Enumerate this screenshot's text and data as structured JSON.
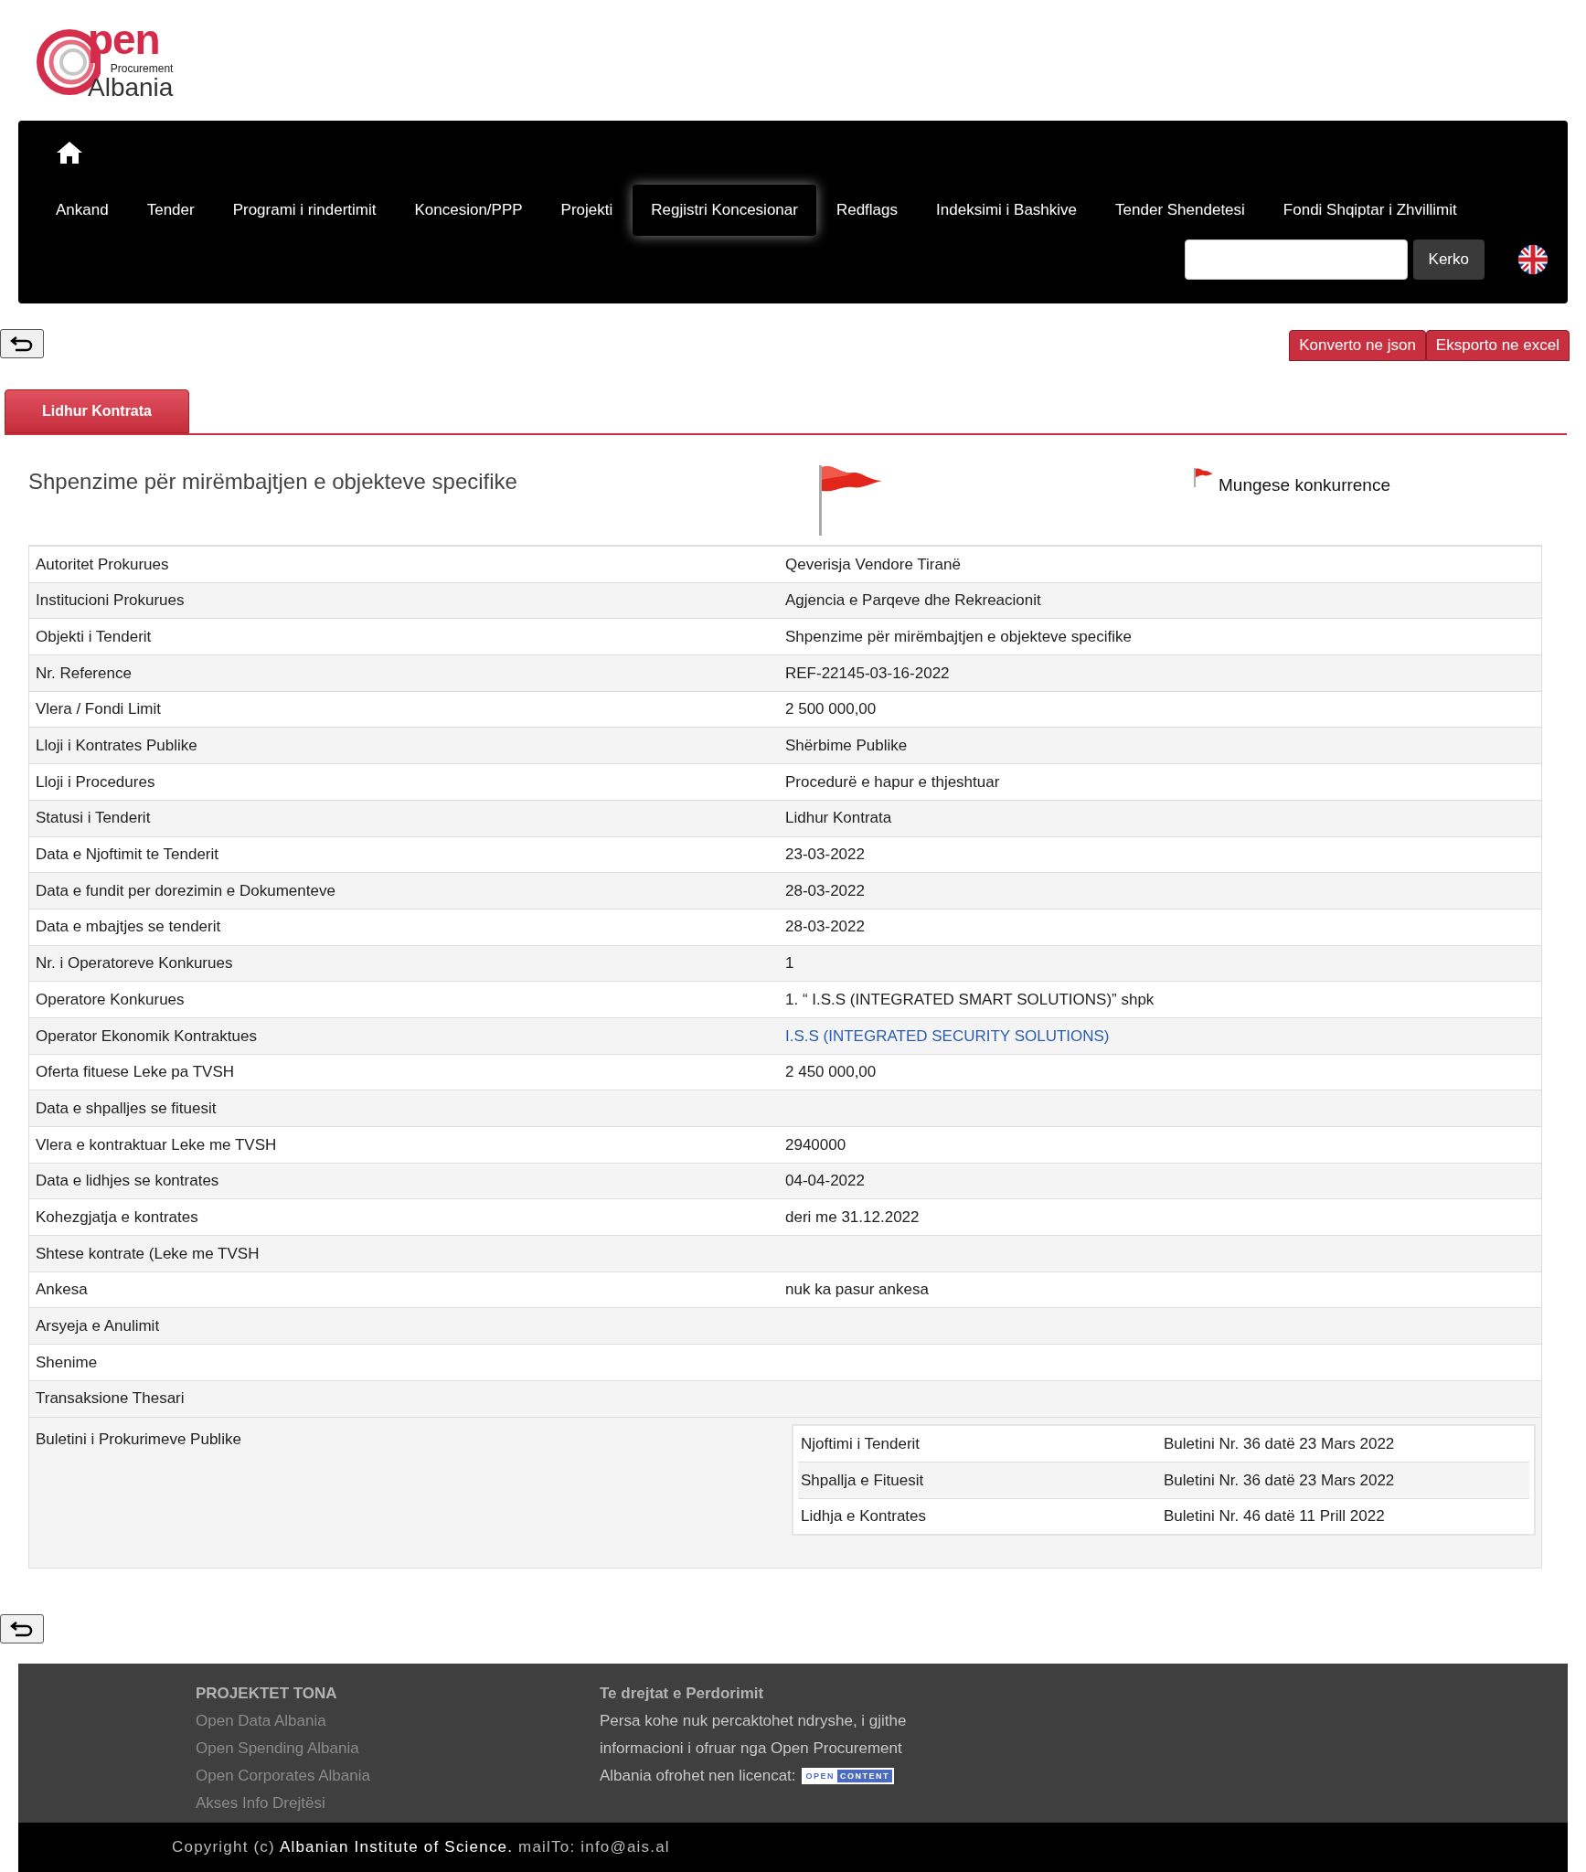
{
  "logo": {
    "word": "pen",
    "tagline": "Procurement",
    "country": "Albania"
  },
  "nav": {
    "items": [
      {
        "label": "Ankand",
        "selected": false
      },
      {
        "label": "Tender",
        "selected": false
      },
      {
        "label": "Programi i rindertimit",
        "selected": false
      },
      {
        "label": "Koncesion/PPP",
        "selected": false
      },
      {
        "label": "Projekti",
        "selected": false
      },
      {
        "label": "Regjistri Koncesionar",
        "selected": true
      },
      {
        "label": "Redflags",
        "selected": false
      },
      {
        "label": "Indeksimi i Bashkive",
        "selected": false
      },
      {
        "label": "Tender Shendetesi",
        "selected": false
      },
      {
        "label": "Fondi Shqiptar i Zhvillimit",
        "selected": false
      }
    ],
    "search_button": "Kerko"
  },
  "export_buttons": [
    "Konverto ne json",
    "Eksporto ne excel"
  ],
  "tabs": [
    {
      "label": "Lidhur Kontrata",
      "selected": true
    }
  ],
  "tender": {
    "title": "Shpenzime për mirëmbajtjen e objekteve specifike",
    "flag_label": "Mungese konkurrence"
  },
  "details": [
    {
      "label": "Autoritet Prokurues",
      "value": "Qeverisja Vendore Tiranë"
    },
    {
      "label": "Institucioni Prokurues",
      "value": "Agjencia e Parqeve dhe Rekreacionit"
    },
    {
      "label": "Objekti i Tenderit",
      "value": "Shpenzime për mirëmbajtjen e objekteve specifike"
    },
    {
      "label": "Nr. Reference",
      "value": "REF-22145-03-16-2022"
    },
    {
      "label": "Vlera / Fondi Limit",
      "value": "2 500 000,00"
    },
    {
      "label": "Lloji i Kontrates Publike",
      "value": "Shërbime Publike"
    },
    {
      "label": "Lloji i Procedures",
      "value": "Procedurë e hapur e thjeshtuar"
    },
    {
      "label": "Statusi i Tenderit",
      "value": "Lidhur Kontrata"
    },
    {
      "label": "Data e Njoftimit te Tenderit",
      "value": "23-03-2022"
    },
    {
      "label": "Data e fundit per dorezimin e Dokumenteve",
      "value": "28-03-2022"
    },
    {
      "label": "Data e mbajtjes se tenderit",
      "value": "28-03-2022"
    },
    {
      "label": "Nr. i Operatoreve Konkurues",
      "value": "1"
    },
    {
      "label": "Operatore Konkurues",
      "value": "1. “ I.S.S (INTEGRATED SMART SOLUTIONS)” shpk"
    },
    {
      "label": "Operator Ekonomik Kontraktues",
      "value": "I.S.S (INTEGRATED SECURITY SOLUTIONS)",
      "kind": "link"
    },
    {
      "label": "Oferta fituese Leke pa TVSH",
      "value": "2 450 000,00"
    },
    {
      "label": "Data e shpalljes se fituesit"
    },
    {
      "label": "Vlera e kontraktuar Leke me TVSH",
      "value": "2940000"
    },
    {
      "label": "Data e lidhjes se kontrates",
      "value": "04-04-2022"
    },
    {
      "label": "Kohezgjatja e kontrates",
      "value": "deri me 31.12.2022"
    },
    {
      "label": "Shtese kontrate (Leke me TVSH"
    },
    {
      "label": "Ankesa",
      "value": "nuk ka pasur ankesa"
    },
    {
      "label": "Arsyeja e Anulimit"
    },
    {
      "label": "Shenime"
    },
    {
      "label": "Transaksione Thesari"
    }
  ],
  "bulletin": {
    "label": "Buletini i Prokurimeve Publike",
    "rows": [
      {
        "stage": "Njoftimi i Tenderit",
        "issue": "Buletini Nr. 36 datë 23 Mars 2022"
      },
      {
        "stage": "Shpallja e Fituesit",
        "issue": "Buletini Nr. 36 datë 23 Mars 2022"
      },
      {
        "stage": "Lidhja e Kontrates",
        "issue": "Buletini Nr. 46 datë 11 Prill 2022"
      }
    ]
  },
  "footer": {
    "projects_heading": "PROJEKTET TONA",
    "projects": [
      "Open Data Albania",
      "Open Spending Albania",
      "Open Corporates Albania",
      "Akses Info Drejtësi"
    ],
    "rights_heading": "Te drejtat e Perdorimit",
    "rights_lines": [
      "Persa kohe nuk percaktohet ndryshe, i gjithe",
      "informacioni i ofruar nga Open Procurement",
      "Albania ofrohet nen licencat:"
    ],
    "license_badge": [
      "OPEN",
      "CONTENT"
    ],
    "copyright": [
      "Copyright (c)",
      "Albanian Institute of Science.",
      "mailTo: info@ais.al"
    ]
  }
}
